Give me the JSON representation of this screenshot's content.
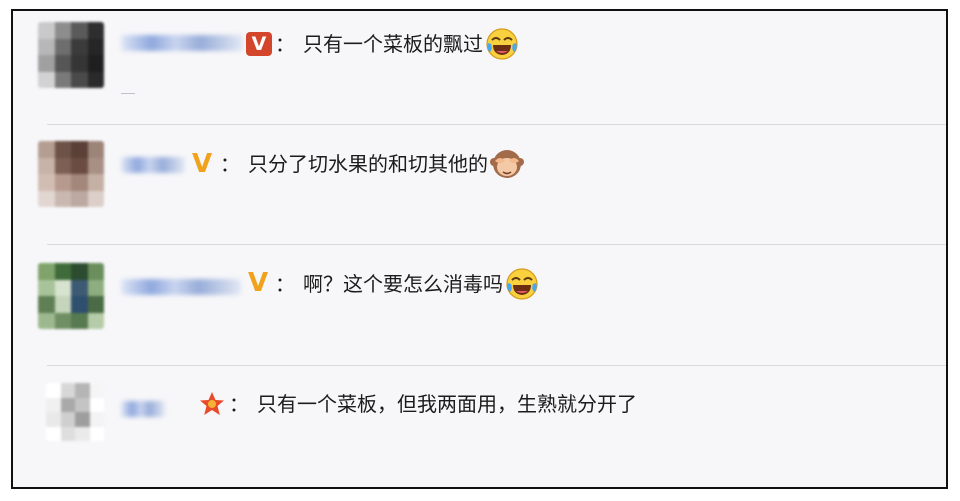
{
  "comments": [
    {
      "separator": "：",
      "text": "只有一个菜板的飘过",
      "emoji": "laughing-crying-emoji",
      "badge": "v-box-red"
    },
    {
      "separator": "：",
      "text": "只分了切水果的和切其他的",
      "emoji": "see-no-evil-monkey-emoji",
      "badge": "v-orange"
    },
    {
      "separator": "：",
      "text": "啊？这个要怎么消毒吗",
      "emoji": "laughing-crying-emoji",
      "badge": "v-orange"
    },
    {
      "separator": "：",
      "text": "只有一个菜板，但我两面用，生熟就分开了",
      "emoji": "",
      "badge": "star-red"
    }
  ],
  "badges": {
    "v_label": "V"
  },
  "colors": {
    "badge_red": "#d3462c",
    "badge_orange": "#f1a21c",
    "divider": "#dadadd",
    "background": "#f7f7f9"
  }
}
